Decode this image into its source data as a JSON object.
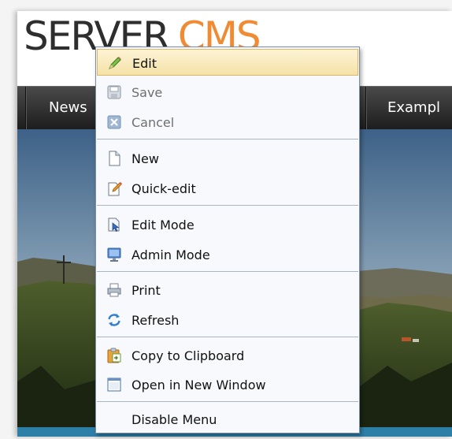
{
  "header": {
    "logo_text_dark": "SERVER",
    "logo_text_accent": "CMS"
  },
  "nav": {
    "items": [
      "News",
      "Exampl"
    ]
  },
  "context_menu": {
    "items": [
      {
        "label": "Edit",
        "icon": "pencil-icon",
        "state": "highlighted"
      },
      {
        "label": "Save",
        "icon": "save-icon",
        "state": "disabled"
      },
      {
        "label": "Cancel",
        "icon": "cancel-icon",
        "state": "disabled"
      },
      {
        "label": "New",
        "icon": "new-page-icon",
        "state": "enabled"
      },
      {
        "label": "Quick-edit",
        "icon": "quick-edit-icon",
        "state": "enabled"
      },
      {
        "label": "Edit Mode",
        "icon": "edit-mode-icon",
        "state": "enabled"
      },
      {
        "label": "Admin Mode",
        "icon": "monitor-icon",
        "state": "enabled"
      },
      {
        "label": "Print",
        "icon": "printer-icon",
        "state": "enabled"
      },
      {
        "label": "Refresh",
        "icon": "refresh-icon",
        "state": "enabled"
      },
      {
        "label": "Copy to Clipboard",
        "icon": "clipboard-icon",
        "state": "enabled"
      },
      {
        "label": "Open in New Window",
        "icon": "window-icon",
        "state": "enabled"
      },
      {
        "label": "Disable Menu",
        "icon": "",
        "state": "enabled"
      }
    ]
  },
  "colors": {
    "logo_accent": "#f08a33",
    "highlight": "#f5e2a7",
    "nav_bar": "#2a2a2a",
    "bottom_bar": "#2e7fa8"
  }
}
